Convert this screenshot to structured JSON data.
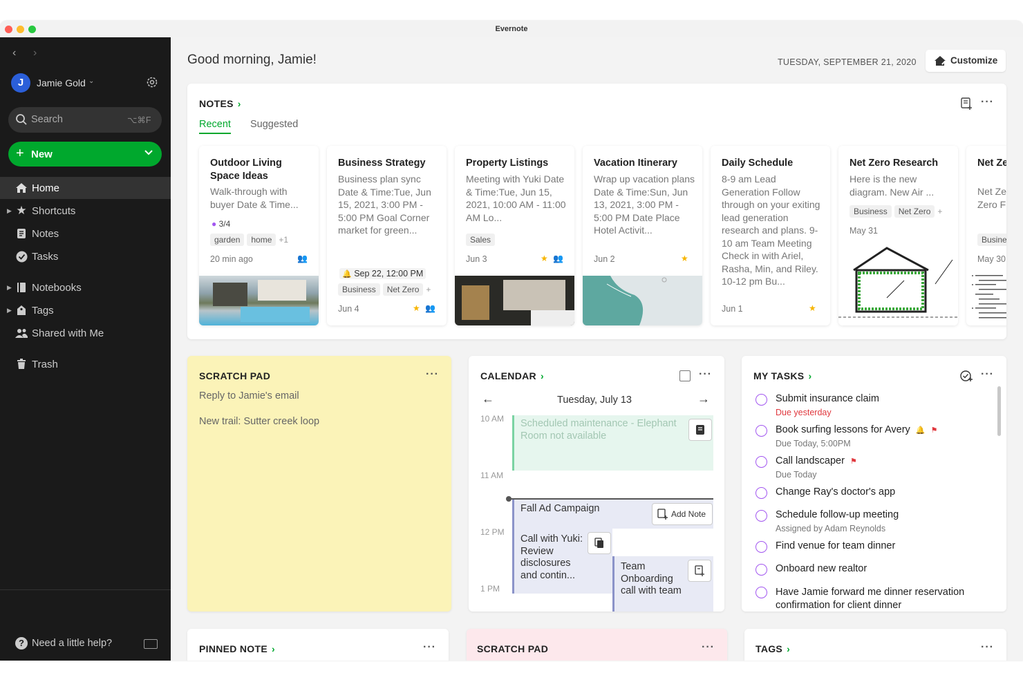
{
  "window": {
    "title": "Evernote"
  },
  "sidebar": {
    "user_initial": "J",
    "user_name": "Jamie Gold",
    "search_placeholder": "Search",
    "search_shortcut": "⌥⌘F",
    "new_label": "New",
    "items": [
      {
        "label": "Home"
      },
      {
        "label": "Shortcuts"
      },
      {
        "label": "Notes"
      },
      {
        "label": "Tasks"
      },
      {
        "label": "Notebooks"
      },
      {
        "label": "Tags"
      },
      {
        "label": "Shared with Me"
      },
      {
        "label": "Trash"
      }
    ],
    "help_label": "Need a little help?"
  },
  "header": {
    "greeting": "Good morning, Jamie!",
    "date": "TUESDAY, SEPTEMBER 21, 2020",
    "customize_label": "Customize"
  },
  "notes_widget": {
    "title": "NOTES",
    "tabs": [
      "Recent",
      "Suggested"
    ],
    "cards": [
      {
        "title": "Outdoor Living Space Ideas",
        "body": "Walk-through with buyer Date & Time...",
        "checklist": "3/4",
        "tags": [
          "garden",
          "home"
        ],
        "more_tags": "+1",
        "date": "20 min ago"
      },
      {
        "title": "Business Strategy",
        "body": "Business plan sync Date & Time:Tue, Jun 15, 2021, 3:00 PM - 5:00 PM Goal Corner market for green...",
        "reminder": "Sep 22, 12:00 PM",
        "tags": [
          "Business",
          "Net Zero"
        ],
        "more_tags": "+",
        "date": "Jun 4"
      },
      {
        "title": "Property Listings",
        "body": "Meeting with Yuki Date & Time:Tue, Jun 15, 2021, 10:00 AM - 11:00 AM Lo...",
        "tags": [
          "Sales"
        ],
        "date": "Jun 3"
      },
      {
        "title": "Vacation Itinerary",
        "body": "Wrap up vacation plans Date & Time:Sun, Jun 13, 2021, 3:00 PM - 5:00 PM Date Place Hotel Activit...",
        "date": "Jun 2"
      },
      {
        "title": "Daily Schedule",
        "body": "8-9 am Lead Generation Follow through on your exiting lead generation research and plans. 9-10 am Team Meeting Check in with Ariel, Rasha, Min, and Riley. 10-12 pm Bu...",
        "date": "Jun  1"
      },
      {
        "title": "Net Zero Research",
        "body": "Here is the new diagram. New Air ...",
        "tags": [
          "Business",
          "Net Zero"
        ],
        "more_tags": "+",
        "date": "May 31"
      },
      {
        "title": "Net Zero Documents",
        "body": "Net Zero Documents Zero F",
        "tags": [
          "Business"
        ],
        "date": "May 30"
      }
    ]
  },
  "scratch_pad": {
    "title": "SCRATCH PAD",
    "lines": [
      "Reply to Jamie's email",
      "New trail: Sutter creek loop"
    ]
  },
  "calendar": {
    "title": "CALENDAR",
    "day": "Tuesday, July 13",
    "hours": [
      "10 AM",
      "11 AM",
      "12 PM",
      "1 PM"
    ],
    "events": [
      {
        "title": "Scheduled maintenance - Elephant Room not available"
      },
      {
        "title": "Fall Ad Campaign",
        "action": "Add Note"
      },
      {
        "title": "Call with Yuki: Review disclosures and contin..."
      },
      {
        "title": "Team Onboarding call with team"
      }
    ]
  },
  "tasks": {
    "title": "MY TASKS",
    "items": [
      {
        "title": "Submit insurance claim",
        "sub": "Due yesterday",
        "overdue": true
      },
      {
        "title": "Book surfing lessons for Avery",
        "sub": "Due Today, 5:00PM"
      },
      {
        "title": "Call landscaper",
        "sub": "Due Today"
      },
      {
        "title": "Change Ray's doctor's app"
      },
      {
        "title": "Schedule follow-up meeting",
        "sub": "Assigned by Adam Reynolds"
      },
      {
        "title": "Find venue for team dinner"
      },
      {
        "title": "Onboard new realtor"
      },
      {
        "title": "Have Jamie forward me dinner reservation confirmation for client dinner"
      }
    ]
  },
  "bottom": {
    "pinned": "PINNED NOTE",
    "scratch": "SCRATCH PAD",
    "tags": "TAGS"
  },
  "colors": {
    "accent": "#00a82d",
    "sidebar": "#1a1a1a",
    "scratch_yellow": "#fbf3b8",
    "scratch_pink": "#fde8ec",
    "task_purple": "#a256f0",
    "overdue": "#e0383e",
    "event_green": "#e6f6ee",
    "event_blue": "#e8eaf5"
  }
}
